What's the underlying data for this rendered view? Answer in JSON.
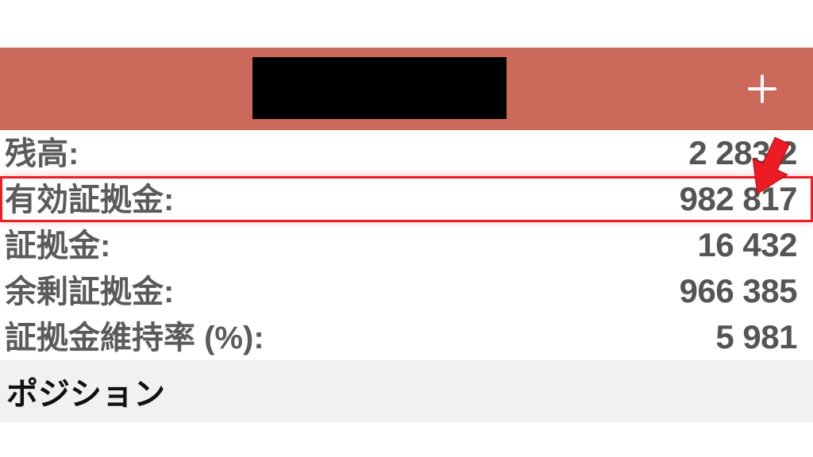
{
  "header": {
    "add_icon": "plus-icon"
  },
  "account": {
    "balance_label": "残高:",
    "balance_value": "2 283    2",
    "equity_label": "有効証拠金:",
    "equity_value": "982 817",
    "margin_label": "証拠金:",
    "margin_value": "16 432",
    "free_margin_label": "余剰証拠金:",
    "free_margin_value": "966 385",
    "margin_level_label": "証拠金維持率 (%):",
    "margin_level_value": "5 981"
  },
  "sections": {
    "positions_label": "ポジション"
  },
  "annotation": {
    "highlight_row": "equity",
    "arrow_color": "#ed1c24"
  }
}
